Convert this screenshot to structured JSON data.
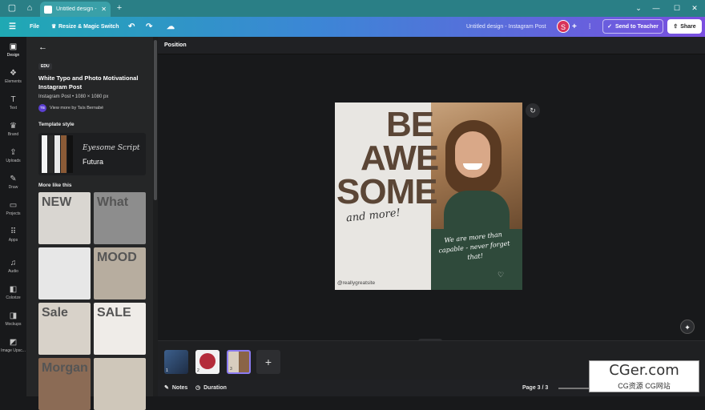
{
  "browser": {
    "tab_title": "Untitled design - In...",
    "new_tab": "+",
    "controls": [
      "⌄",
      "—",
      "☐",
      "✕"
    ]
  },
  "topbar": {
    "menu_icon": "☰",
    "file": "File",
    "resize": "Resize & Magic Switch",
    "doc_title": "Untitled design - Instagram Post",
    "avatar_letter": "S",
    "send": "Send to Teacher",
    "share": "Share"
  },
  "rail": [
    {
      "label": "Design",
      "icon": "▣"
    },
    {
      "label": "Elements",
      "icon": "❖"
    },
    {
      "label": "Text",
      "icon": "T"
    },
    {
      "label": "Brand",
      "icon": "♛"
    },
    {
      "label": "Uploads",
      "icon": "⇪"
    },
    {
      "label": "Draw",
      "icon": "✎"
    },
    {
      "label": "Projects",
      "icon": "▭"
    },
    {
      "label": "Apps",
      "icon": "⠿"
    },
    {
      "label": "Audio",
      "icon": "♫"
    },
    {
      "label": "Colorize",
      "icon": "◧"
    },
    {
      "label": "Mockups",
      "icon": "◨"
    },
    {
      "label": "Image Upsc...",
      "icon": "◩"
    }
  ],
  "panel": {
    "badge": "EDU",
    "title": "White Typo and Photo Motivational Instagram Post",
    "meta": "Instagram Post • 1080 × 1080 px",
    "author_initials": "TB",
    "author": "View more by Taís Bernabé",
    "template_style": "Template style",
    "font1": "Eyesome Script",
    "font2": "Futura",
    "more_like": "More like this",
    "thumbs": [
      {
        "text": "NEW",
        "bg": "#d9d6d1"
      },
      {
        "text": "What",
        "bg": "#8d8d8d"
      },
      {
        "text": "",
        "bg": "#e7e7e7"
      },
      {
        "text": "MOOD",
        "bg": "#b7ad9f"
      },
      {
        "text": "Sale",
        "bg": "#d8d2c9"
      },
      {
        "text": "SALE",
        "bg": "#efece8"
      },
      {
        "text": "Morgan",
        "bg": "#8b6b55"
      },
      {
        "text": "",
        "bg": "#cfc7ba"
      }
    ]
  },
  "canvas": {
    "position": "Position",
    "words": [
      "BE",
      "AWE",
      "SOME"
    ],
    "script1": "and more!",
    "script2": "We are more than capable - never forget that!",
    "handle": "@reallygreatsite"
  },
  "pages": {
    "thumbs": [
      "1",
      "2",
      "3"
    ],
    "add": "+",
    "notes": "Notes",
    "duration": "Duration",
    "page_indicator": "Page 3 / 3"
  },
  "watermark": {
    "line1": "CGer.com",
    "line2": "CG资源 CG网站"
  }
}
